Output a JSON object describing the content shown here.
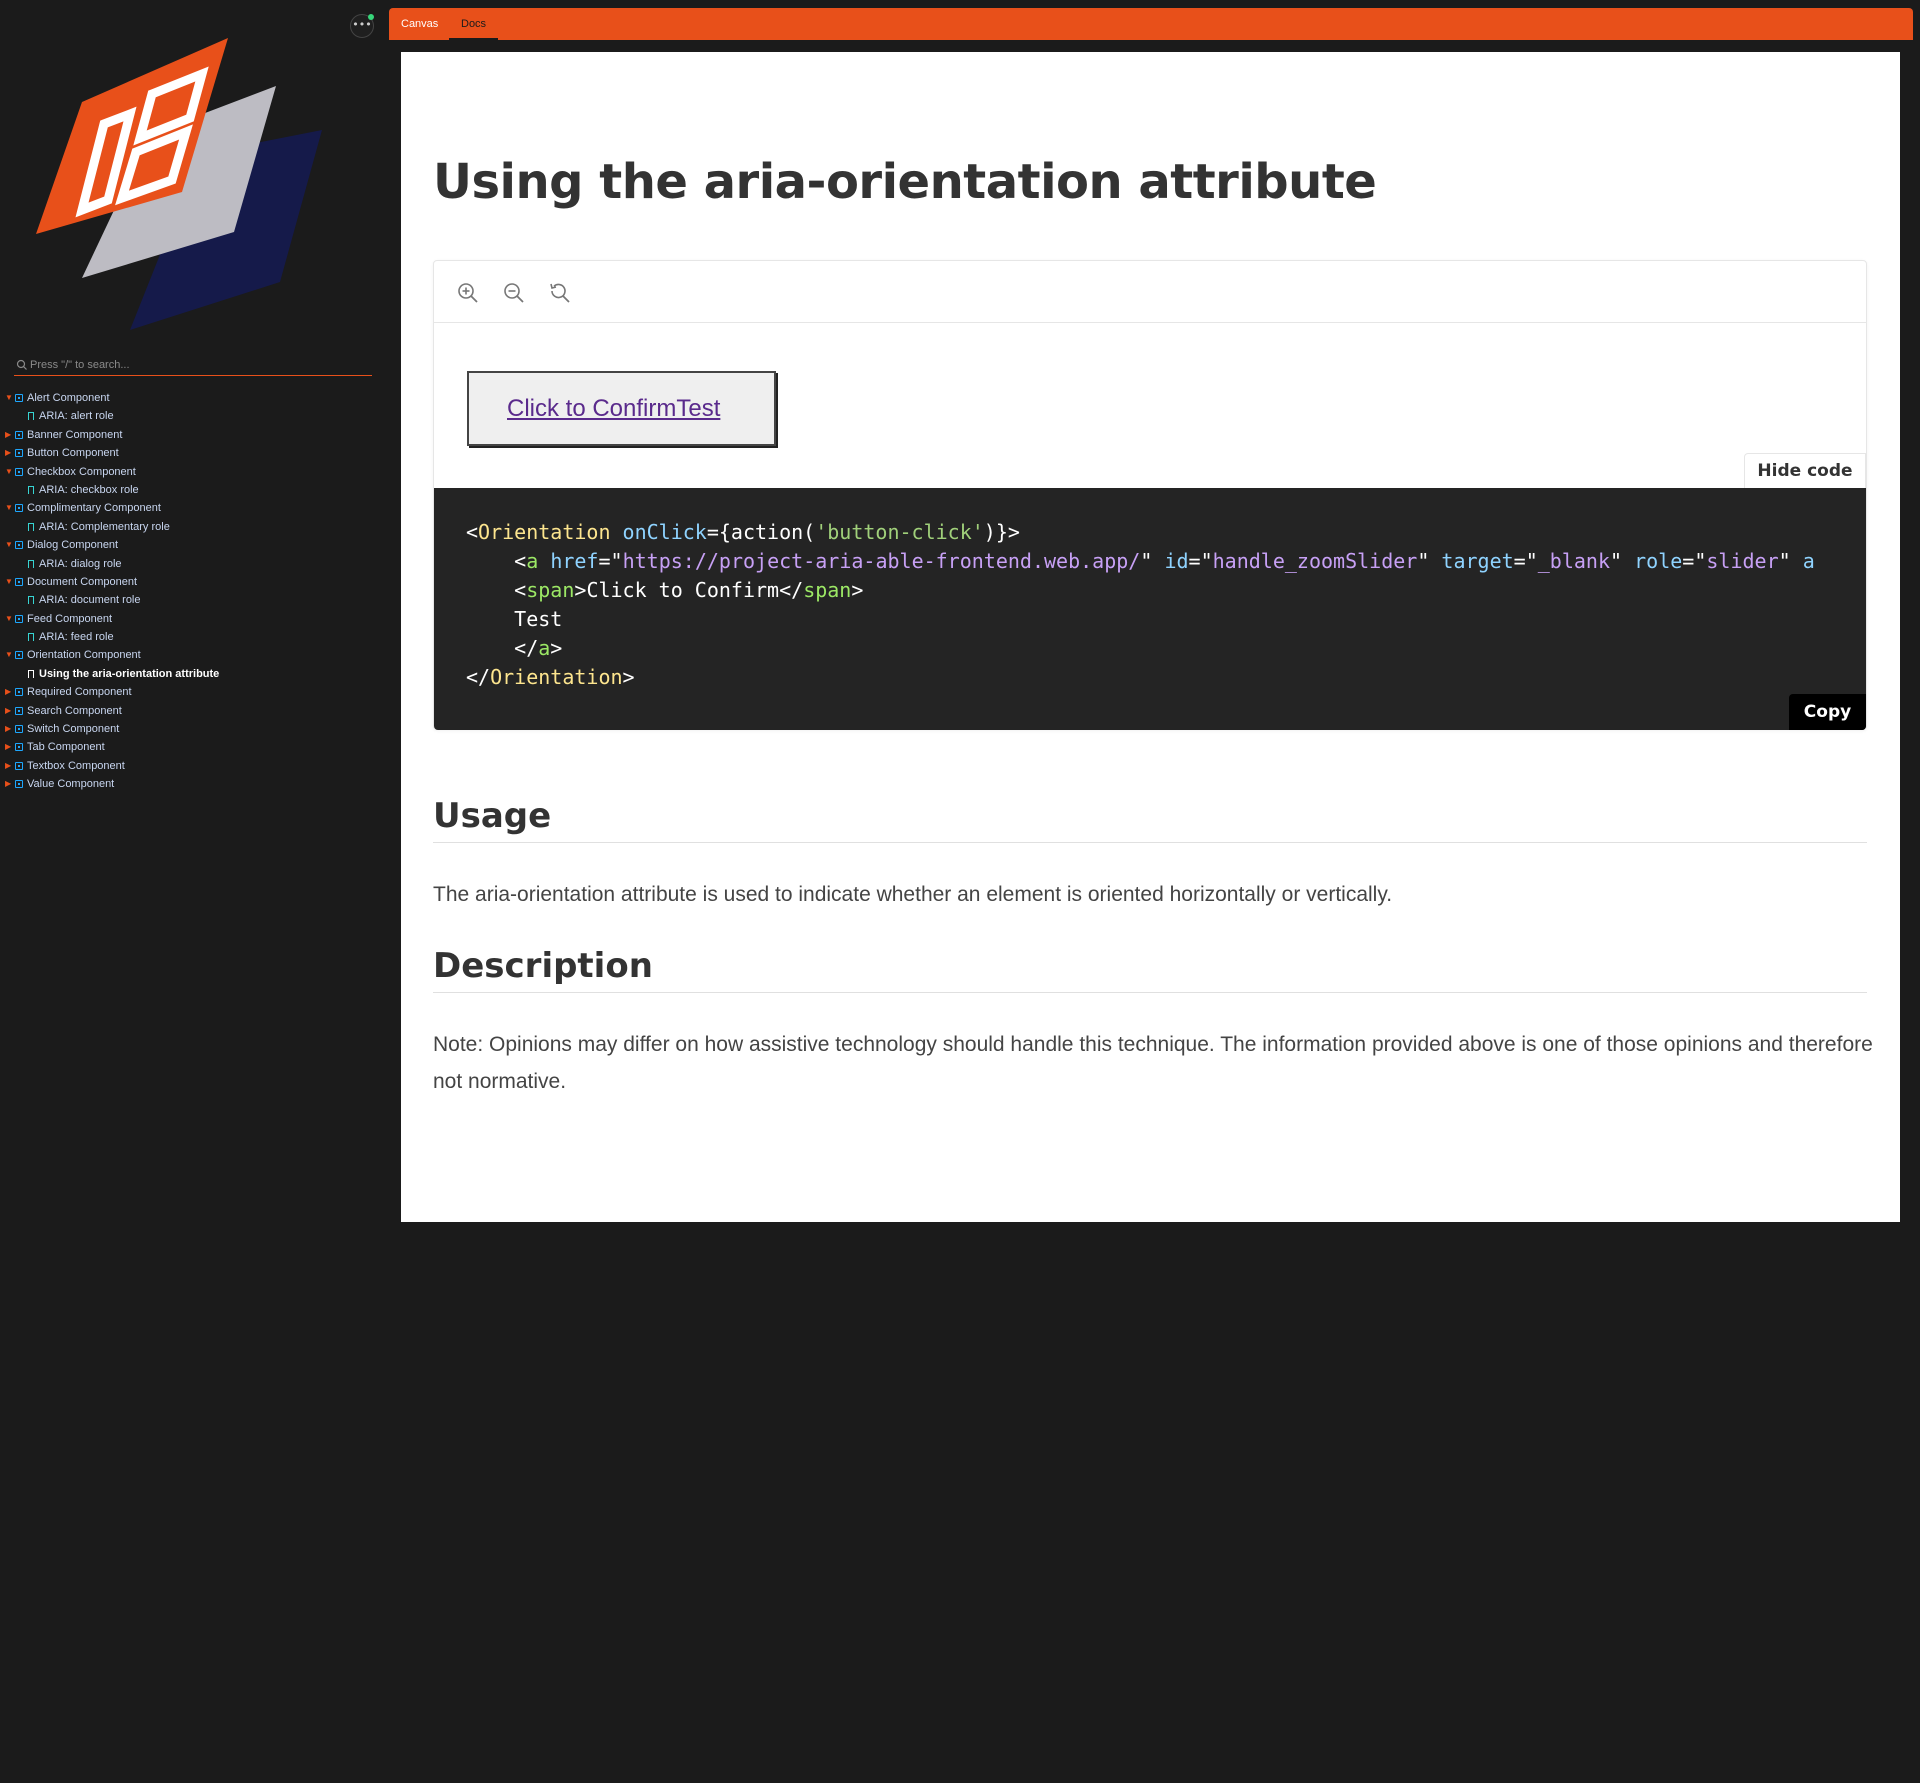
{
  "sidebar": {
    "menu_icon": "ellipsis-icon",
    "search_placeholder": "Press \"/\" to search...",
    "tree": [
      {
        "type": "component",
        "label": "Alert Component",
        "expanded": true
      },
      {
        "type": "doc",
        "label": "ARIA: alert role"
      },
      {
        "type": "component",
        "label": "Banner Component",
        "expanded": false
      },
      {
        "type": "component",
        "label": "Button Component",
        "expanded": false
      },
      {
        "type": "component",
        "label": "Checkbox Component",
        "expanded": true
      },
      {
        "type": "doc",
        "label": "ARIA: checkbox role"
      },
      {
        "type": "component",
        "label": "Complimentary Component",
        "expanded": true
      },
      {
        "type": "doc",
        "label": "ARIA: Complementary role"
      },
      {
        "type": "component",
        "label": "Dialog Component",
        "expanded": true
      },
      {
        "type": "doc",
        "label": "ARIA: dialog role"
      },
      {
        "type": "component",
        "label": "Document Component",
        "expanded": true
      },
      {
        "type": "doc",
        "label": "ARIA: document role"
      },
      {
        "type": "component",
        "label": "Feed Component",
        "expanded": true
      },
      {
        "type": "doc",
        "label": "ARIA: feed role"
      },
      {
        "type": "component",
        "label": "Orientation Component",
        "expanded": true
      },
      {
        "type": "doc",
        "label": "Using the aria-orientation attribute",
        "active": true
      },
      {
        "type": "component",
        "label": "Required Component",
        "expanded": false
      },
      {
        "type": "component",
        "label": "Search Component",
        "expanded": false
      },
      {
        "type": "component",
        "label": "Switch Component",
        "expanded": false
      },
      {
        "type": "component",
        "label": "Tab Component",
        "expanded": false
      },
      {
        "type": "component",
        "label": "Textbox Component",
        "expanded": false
      },
      {
        "type": "component",
        "label": "Value Component",
        "expanded": false
      }
    ]
  },
  "toolbar": {
    "tabs": [
      {
        "label": "Canvas"
      },
      {
        "label": "Docs"
      }
    ],
    "accent_color": "#e8501a"
  },
  "docs": {
    "title": "Using the aria-orientation attribute",
    "preview": {
      "link_text": "Click to ConfirmTest",
      "hide_code_label": "Hide code",
      "copy_label": "Copy",
      "tools": [
        "zoom-in-icon",
        "zoom-out-icon",
        "reset-zoom-icon"
      ],
      "code": {
        "l1_tag": "Orientation",
        "l1_attr": "onClick",
        "l1_val_pre": "={action(",
        "l1_str": "'button-click'",
        "l1_val_post": ")}>",
        "l2_tag": "a",
        "l2_attr1": "href",
        "l2_str1": "https://project-aria-able-frontend.web.app/",
        "l2_attr2": "id",
        "l2_str2": "handle_zoomSlider",
        "l2_attr3": "target",
        "l2_str3": "_blank",
        "l2_attr4": "role",
        "l2_str4": "slider",
        "l2_attr5": "a",
        "l3_tag": "span",
        "l3_text": "Click to Confirm",
        "l4_text": "Test",
        "l5_tag": "a",
        "l6_tag": "Orientation"
      }
    },
    "usage_heading": "Usage",
    "usage_text": "The aria-orientation attribute is used to indicate whether an element is oriented horizontally or vertically.",
    "description_heading": "Description",
    "description_text": "Note: Opinions may differ on how assistive technology should handle this technique. The information provided above is one of those opinions and therefore not normative."
  }
}
